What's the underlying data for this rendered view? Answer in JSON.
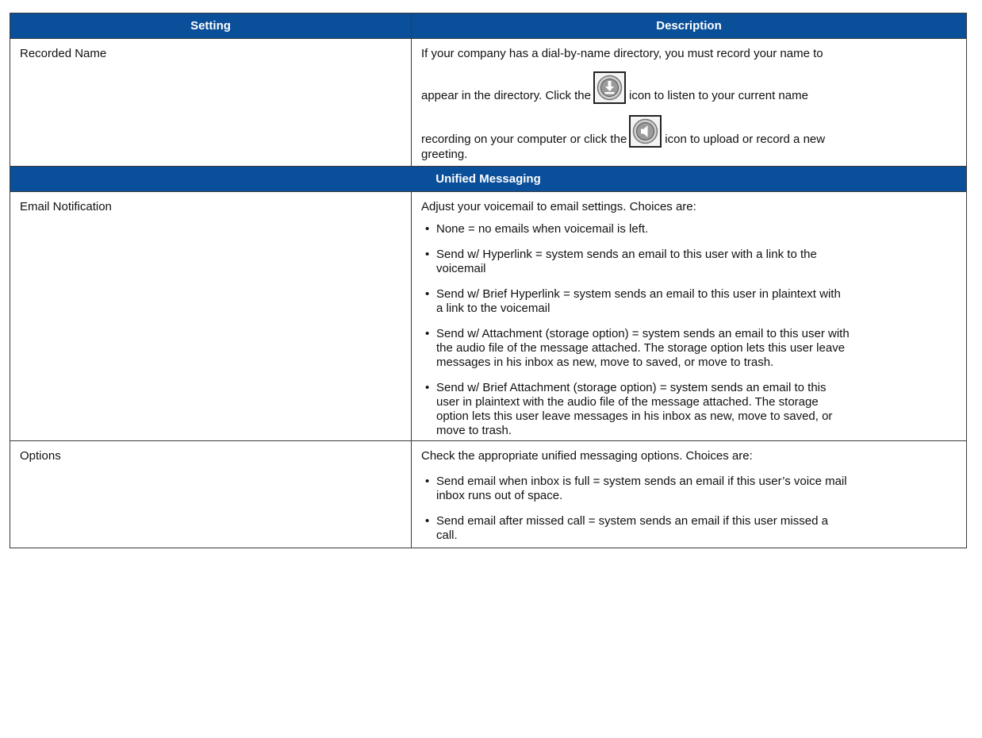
{
  "headers": {
    "setting": "Setting",
    "description": "Description"
  },
  "recorded_name": {
    "setting": "Recorded Name",
    "line1": "If your company has a dial-by-name directory, you must record your name to",
    "line2_before": "appear in the directory. Click the",
    "line2_after": "icon to listen to your current name",
    "line3_before": "recording on your computer or click the",
    "line3_after": "icon to upload or record a new",
    "line4": "greeting.",
    "icon1": "download-icon",
    "icon2": "speaker-icon"
  },
  "section_title": "Unified Messaging",
  "email_notification": {
    "setting": "Email Notification",
    "intro": "Adjust your voicemail to email settings. Choices are:",
    "bullets": [
      [
        "None = no emails when voicemail is left."
      ],
      [
        "Send w/ Hyperlink = system sends an email to this user with a link to the",
        "voicemail"
      ],
      [
        "Send w/ Brief Hyperlink = system sends an email to this user in plaintext with",
        "a link to the voicemail"
      ],
      [
        "Send w/ Attachment (storage option) = system sends an email to this user with",
        "the audio file of the message attached. The storage option lets this user leave",
        "messages in his inbox as new, move to saved, or move to trash."
      ],
      [
        "Send w/ Brief Attachment (storage option) = system sends an email to this",
        "user in plaintext with the audio file of the message attached. The storage",
        "option lets this user leave messages in his inbox as new, move to saved, or",
        "move to trash."
      ]
    ]
  },
  "options": {
    "setting": "Options",
    "intro": "Check the appropriate unified messaging options. Choices are:",
    "bullets": [
      [
        "Send email when inbox is full = system sends an email if this user’s voice mail",
        "inbox runs out of space."
      ],
      [
        "Send email after missed call = system sends an email if this user missed a",
        "call."
      ]
    ]
  },
  "bullet_char": "•",
  "colors": {
    "header_bg": "#0a4f9a",
    "header_text": "#ffffff",
    "border": "#3a3a3a"
  }
}
